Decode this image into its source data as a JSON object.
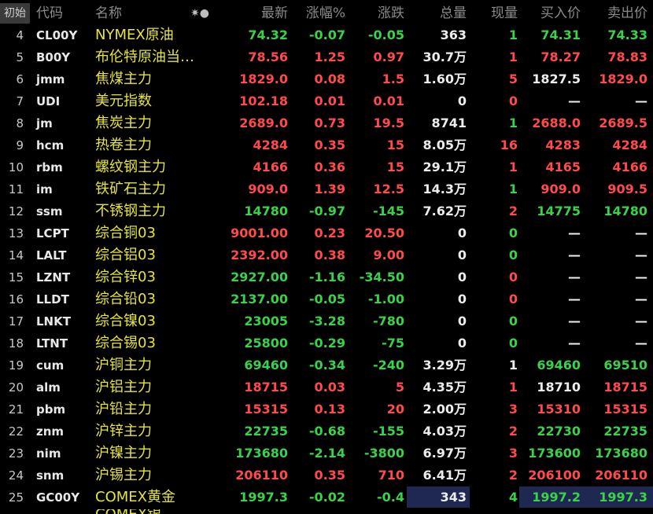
{
  "header": {
    "init_label": "初始",
    "col_code": "代码",
    "col_name": "名称",
    "col_settings_glyph": "✷●",
    "col_last": "最新",
    "col_pct": "涨幅%",
    "col_change": "涨跌",
    "col_volume": "总量",
    "col_current": "现量",
    "col_bid": "买入价",
    "col_ask": "卖出价"
  },
  "colors": {
    "up": "#ff4b4b",
    "down": "#3bd14a",
    "name": "#e4e43a",
    "highlight": "#1e2850"
  },
  "rows": [
    {
      "idx": "4",
      "code": "CL00Y",
      "name": "NYMEX原油",
      "last": "74.32",
      "pct": "-0.07",
      "chg": "-0.05",
      "vol": "363",
      "cur": "1",
      "bid": "74.31",
      "ask": "74.33",
      "dir": "dn"
    },
    {
      "idx": "5",
      "code": "B00Y",
      "name": "布伦特原油当…",
      "last": "78.56",
      "pct": "1.25",
      "chg": "0.97",
      "vol": "30.7万",
      "cur": "1",
      "bid": "78.27",
      "ask": "78.83",
      "dir": "up"
    },
    {
      "idx": "6",
      "code": "jmm",
      "name": "焦煤主力",
      "last": "1829.0",
      "pct": "0.08",
      "chg": "1.5",
      "vol": "1.60万",
      "cur": "5",
      "bid": "1827.5",
      "ask": "1829.0",
      "dir": "up"
    },
    {
      "idx": "7",
      "code": "UDI",
      "name": "美元指数",
      "last": "102.18",
      "pct": "0.01",
      "chg": "0.01",
      "vol": "0",
      "cur": "0",
      "bid": "—",
      "ask": "—",
      "dir": "up"
    },
    {
      "idx": "8",
      "code": "jm",
      "name": "焦炭主力",
      "last": "2689.0",
      "pct": "0.73",
      "chg": "19.5",
      "vol": "8741",
      "cur": "1",
      "bid": "2688.0",
      "ask": "2689.5",
      "dir": "up"
    },
    {
      "idx": "9",
      "code": "hcm",
      "name": "热卷主力",
      "last": "4284",
      "pct": "0.35",
      "chg": "15",
      "vol": "8.05万",
      "cur": "16",
      "bid": "4283",
      "ask": "4284",
      "dir": "up"
    },
    {
      "idx": "10",
      "code": "rbm",
      "name": "螺纹钢主力",
      "last": "4166",
      "pct": "0.36",
      "chg": "15",
      "vol": "29.1万",
      "cur": "1",
      "bid": "4165",
      "ask": "4166",
      "dir": "up"
    },
    {
      "idx": "11",
      "code": "im",
      "name": "铁矿石主力",
      "last": "909.0",
      "pct": "1.39",
      "chg": "12.5",
      "vol": "14.3万",
      "cur": "1",
      "bid": "909.0",
      "ask": "909.5",
      "dir": "up"
    },
    {
      "idx": "12",
      "code": "ssm",
      "name": "不锈钢主力",
      "last": "14780",
      "pct": "-0.97",
      "chg": "-145",
      "vol": "7.62万",
      "cur": "2",
      "bid": "14775",
      "ask": "14780",
      "dir": "dn"
    },
    {
      "idx": "13",
      "code": "LCPT",
      "name": "综合铜03",
      "last": "9001.00",
      "pct": "0.23",
      "chg": "20.50",
      "vol": "0",
      "cur": "0",
      "bid": "—",
      "ask": "—",
      "dir": "up"
    },
    {
      "idx": "14",
      "code": "LALT",
      "name": "综合铝03",
      "last": "2392.00",
      "pct": "0.38",
      "chg": "9.00",
      "vol": "0",
      "cur": "0",
      "bid": "—",
      "ask": "—",
      "dir": "up"
    },
    {
      "idx": "15",
      "code": "LZNT",
      "name": "综合锌03",
      "last": "2927.00",
      "pct": "-1.16",
      "chg": "-34.50",
      "vol": "0",
      "cur": "0",
      "bid": "—",
      "ask": "—",
      "dir": "dn"
    },
    {
      "idx": "16",
      "code": "LLDT",
      "name": "综合铅03",
      "last": "2137.00",
      "pct": "-0.05",
      "chg": "-1.00",
      "vol": "0",
      "cur": "0",
      "bid": "—",
      "ask": "—",
      "dir": "dn"
    },
    {
      "idx": "17",
      "code": "LNKT",
      "name": "综合镍03",
      "last": "23005",
      "pct": "-3.28",
      "chg": "-780",
      "vol": "0",
      "cur": "0",
      "bid": "—",
      "ask": "—",
      "dir": "dn"
    },
    {
      "idx": "18",
      "code": "LTNT",
      "name": "综合锡03",
      "last": "25800",
      "pct": "-0.29",
      "chg": "-75",
      "vol": "0",
      "cur": "0",
      "bid": "—",
      "ask": "—",
      "dir": "dn"
    },
    {
      "idx": "19",
      "code": "cum",
      "name": "沪铜主力",
      "last": "69460",
      "pct": "-0.34",
      "chg": "-240",
      "vol": "3.29万",
      "cur": "1",
      "bid": "69460",
      "ask": "69510",
      "dir": "dn"
    },
    {
      "idx": "20",
      "code": "alm",
      "name": "沪铝主力",
      "last": "18715",
      "pct": "0.03",
      "chg": "5",
      "vol": "4.35万",
      "cur": "1",
      "bid": "18710",
      "ask": "18715",
      "dir": "up"
    },
    {
      "idx": "21",
      "code": "pbm",
      "name": "沪铅主力",
      "last": "15315",
      "pct": "0.13",
      "chg": "20",
      "vol": "2.00万",
      "cur": "3",
      "bid": "15310",
      "ask": "15315",
      "dir": "up"
    },
    {
      "idx": "22",
      "code": "znm",
      "name": "沪锌主力",
      "last": "22735",
      "pct": "-0.68",
      "chg": "-155",
      "vol": "4.03万",
      "cur": "2",
      "bid": "22730",
      "ask": "22735",
      "dir": "dn"
    },
    {
      "idx": "23",
      "code": "nim",
      "name": "沪镍主力",
      "last": "173680",
      "pct": "-2.14",
      "chg": "-3800",
      "vol": "6.97万",
      "cur": "3",
      "bid": "173600",
      "ask": "173680",
      "dir": "dn"
    },
    {
      "idx": "24",
      "code": "snm",
      "name": "沪锡主力",
      "last": "206110",
      "pct": "0.35",
      "chg": "710",
      "vol": "6.41万",
      "cur": "2",
      "bid": "206100",
      "ask": "206110",
      "dir": "up"
    },
    {
      "idx": "25",
      "code": "GC00Y",
      "name": "COMEX黄金",
      "last": "1997.3",
      "pct": "-0.02",
      "chg": "-0.4",
      "vol": "343",
      "cur": "4",
      "bid": "1997.2",
      "ask": "1997.3",
      "dir": "dn"
    }
  ],
  "cells_color": {
    "4": {
      "cur": "dn",
      "bid": "dn",
      "ask": "dn"
    },
    "5": {
      "cur": "up",
      "bid": "up",
      "ask": "up"
    },
    "6": {
      "cur": "up",
      "bid": "flat",
      "ask": "up"
    },
    "7": {
      "cur": "up",
      "bid": "flat",
      "ask": "flat"
    },
    "8": {
      "cur": "dn",
      "bid": "up",
      "ask": "up"
    },
    "9": {
      "cur": "up",
      "bid": "up",
      "ask": "up"
    },
    "10": {
      "cur": "up",
      "bid": "up",
      "ask": "up"
    },
    "11": {
      "cur": "dn",
      "bid": "up",
      "ask": "up"
    },
    "12": {
      "cur": "up",
      "bid": "dn",
      "ask": "dn"
    },
    "13": {
      "cur": "dn",
      "bid": "flat",
      "ask": "flat"
    },
    "14": {
      "cur": "dn",
      "bid": "flat",
      "ask": "flat"
    },
    "15": {
      "cur": "up",
      "bid": "flat",
      "ask": "flat"
    },
    "16": {
      "cur": "up",
      "bid": "flat",
      "ask": "flat"
    },
    "17": {
      "cur": "dn",
      "bid": "flat",
      "ask": "flat"
    },
    "18": {
      "cur": "dn",
      "bid": "flat",
      "ask": "flat"
    },
    "19": {
      "cur": "flat",
      "bid": "dn",
      "ask": "dn"
    },
    "20": {
      "cur": "up",
      "bid": "flat",
      "ask": "up"
    },
    "21": {
      "cur": "up",
      "bid": "up",
      "ask": "up"
    },
    "22": {
      "cur": "up",
      "bid": "dn",
      "ask": "dn"
    },
    "23": {
      "cur": "up",
      "bid": "dn",
      "ask": "dn"
    },
    "24": {
      "cur": "up",
      "bid": "up",
      "ask": "up"
    },
    "25": {
      "cur": "dn",
      "bid": "dn",
      "ask": "dn"
    }
  },
  "partial_row_name": "COMEX银"
}
